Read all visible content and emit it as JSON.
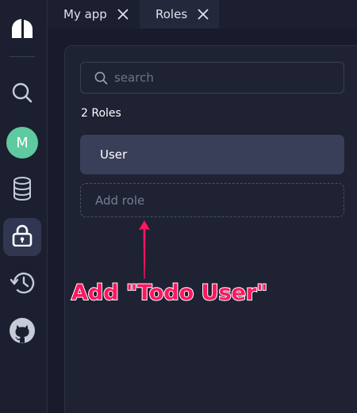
{
  "tabs": [
    {
      "label": "My app",
      "active": false
    },
    {
      "label": "Roles",
      "active": true
    }
  ],
  "sidebar": {
    "items": [
      {
        "icon": "logo-icon"
      },
      {
        "icon": "search-icon"
      },
      {
        "icon": "avatar",
        "initial": "M",
        "color": "#5fc9a0"
      },
      {
        "icon": "database-icon"
      },
      {
        "icon": "lock-icon",
        "active": true
      },
      {
        "icon": "history-icon"
      },
      {
        "icon": "github-icon"
      }
    ]
  },
  "search": {
    "placeholder": "search"
  },
  "roles": {
    "count_label": "2 Roles",
    "items": [
      {
        "label": "User"
      }
    ],
    "add_placeholder": "Add role"
  },
  "annotation": {
    "text": "Add \"Todo User\"",
    "color": "#ff1660"
  },
  "colors": {
    "background": "#171b2b",
    "panel": "#1e2233",
    "active": "#313750",
    "role_item": "#3a3f59"
  }
}
